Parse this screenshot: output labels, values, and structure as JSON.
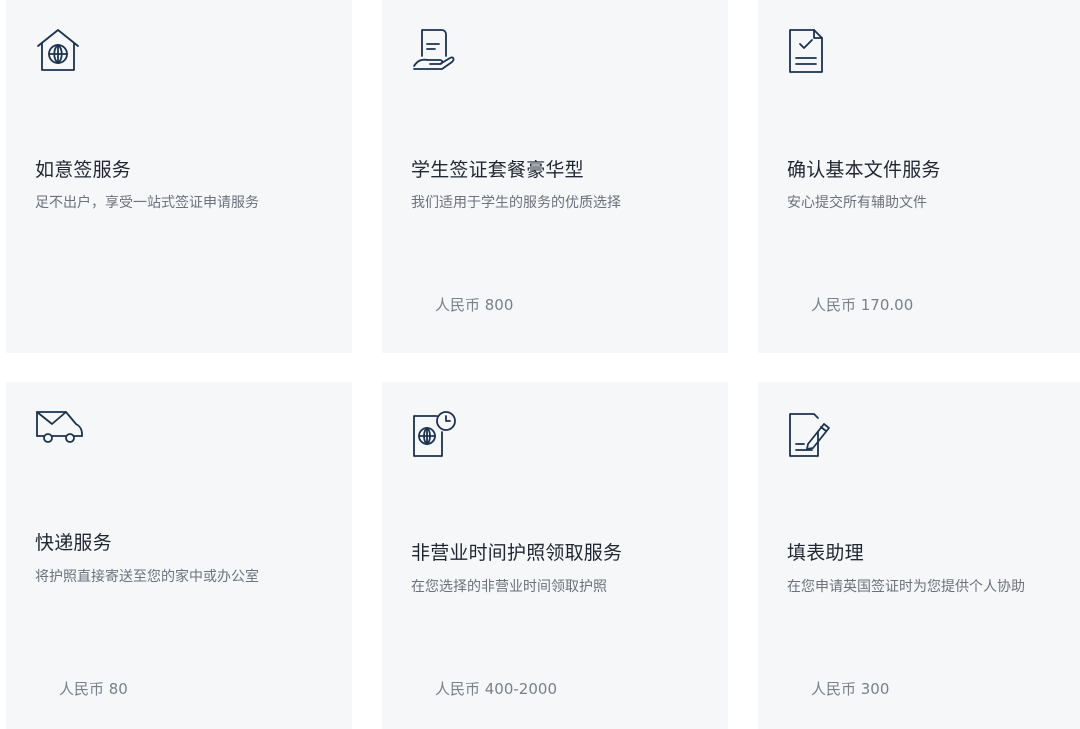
{
  "services": [
    {
      "icon": "house-globe-icon",
      "title": "如意签服务",
      "desc": "足不出户，享受一站式签证申请服务",
      "price": ""
    },
    {
      "icon": "hand-document-icon",
      "title": "学生签证套餐豪华型",
      "desc": "我们适用于学生的服务的优质选择",
      "price": "人民币 800"
    },
    {
      "icon": "document-check-icon",
      "title": "确认基本文件服务",
      "desc": "安心提交所有辅助文件",
      "price": "人民币 170.00"
    },
    {
      "icon": "delivery-van-icon",
      "title": "快递服务",
      "desc": "将护照直接寄送至您的家中或办公室",
      "price": "人民币 80"
    },
    {
      "icon": "passport-clock-icon",
      "title": "非营业时间护照领取服务",
      "desc": "在您选择的非营业时间领取护照",
      "price": "人民币 400-2000"
    },
    {
      "icon": "form-pen-icon",
      "title": "填表助理",
      "desc": "在您申请英国签证时为您提供个人协助",
      "price": "人民币 300"
    }
  ]
}
